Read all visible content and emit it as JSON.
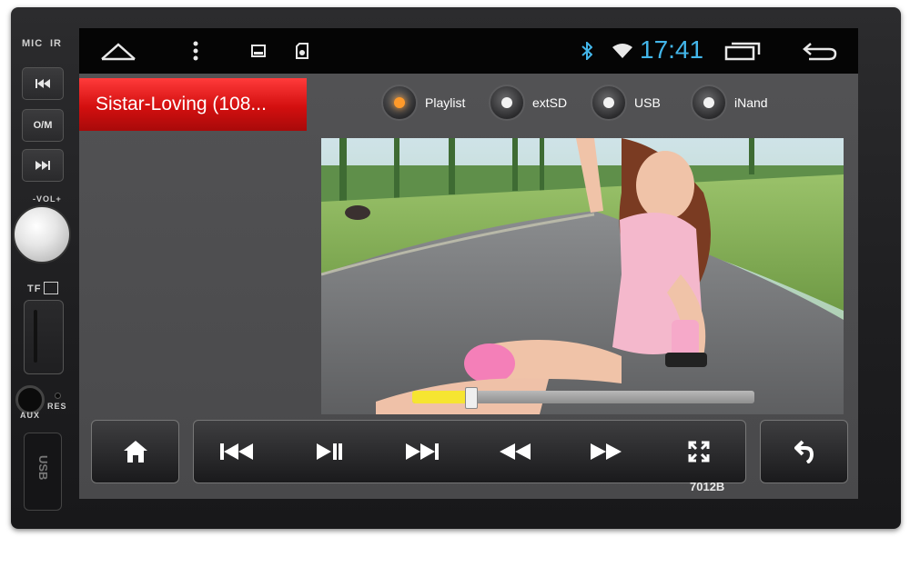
{
  "device": {
    "mic_label": "MIC",
    "ir_label": "IR",
    "mode_button_label": "O/M",
    "vol_label": "-VOL+",
    "tf_label": "TF",
    "aux_label": "AUX",
    "res_label": "RES",
    "usb_label": "USB",
    "model": "7012B"
  },
  "status_bar": {
    "time": "17:41",
    "icons": [
      "home-outline-icon",
      "overflow-menu-icon",
      "image-icon",
      "sd-card-icon",
      "bluetooth-icon",
      "wifi-icon",
      "recent-apps-icon",
      "back-icon"
    ]
  },
  "player": {
    "track_title": "Sistar-Loving (108...",
    "sources": [
      {
        "label": "Playlist",
        "active": true
      },
      {
        "label": "extSD",
        "active": false
      },
      {
        "label": "USB",
        "active": false
      },
      {
        "label": "iNand",
        "active": false
      }
    ],
    "progress": 0.17
  },
  "controls": {
    "buttons": [
      "home-icon",
      "skip-previous-icon",
      "play-pause-icon",
      "skip-next-icon",
      "rewind-icon",
      "fast-forward-icon",
      "fullscreen-icon",
      "return-icon"
    ]
  },
  "colors": {
    "title_bar": "#e01818",
    "accent": "#43b6ea",
    "active_source": "#ff9a2a",
    "progress_fill": "#f6e531"
  }
}
